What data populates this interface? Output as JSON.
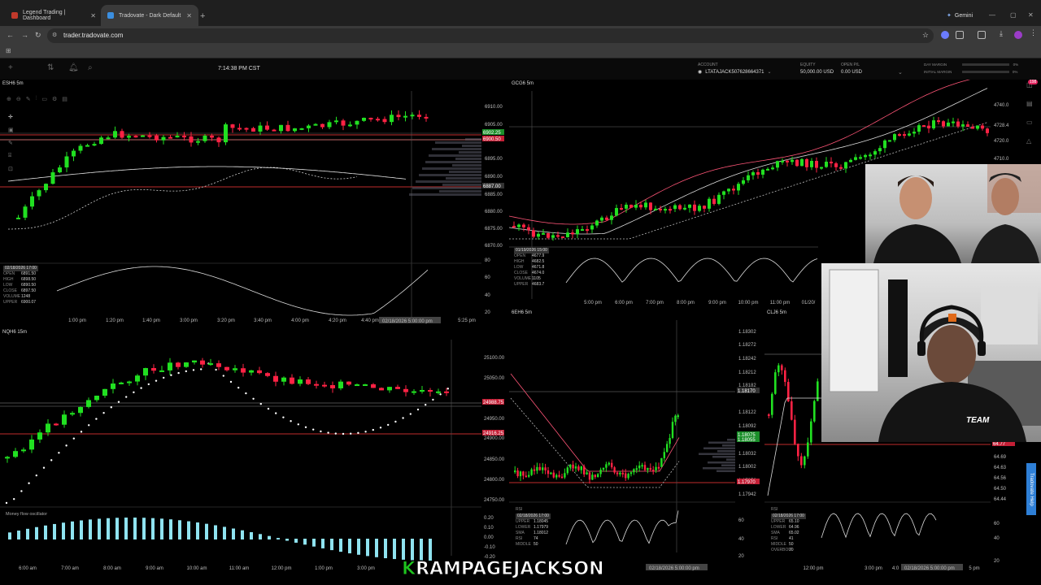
{
  "browser": {
    "tabs": [
      {
        "title": "Legend Trading | Dashboard",
        "active": false,
        "favicon_color": "#c0392b"
      },
      {
        "title": "Tradovate - Dark Default",
        "active": true,
        "favicon_color": "#3b8fe0"
      }
    ],
    "new_tab": "+",
    "gemini": "Gemini",
    "url": "trader.tradovate.com"
  },
  "app": {
    "clock": "7:14:38 PM CST",
    "account_label": "ACCOUNT",
    "account_value": "LTATAJACK507628664371",
    "equity_label": "EQUITY",
    "equity_value": "50,000.00 USD",
    "open_pl_label": "OPEN P/L",
    "open_pl_value": "0.00 USD",
    "day_margin_label": "DAY MARGIN",
    "day_margin_value": "0%",
    "initial_margin_label": "INITIAL MARGIN",
    "initial_margin_value": "0%",
    "notification_count": "198"
  },
  "panels": {
    "es": {
      "title": "ESH6 5m",
      "prices": [
        "6910.00",
        "6905.00",
        "6895.00",
        "6890.00",
        "6885.00",
        "6880.00",
        "6875.00",
        "6870.00"
      ],
      "tags": [
        "6902.25",
        "6900.50",
        "6887.00"
      ],
      "times": [
        "1:00 pm",
        "1:20 pm",
        "1:40 pm",
        "3:00 pm",
        "3:20 pm",
        "3:40 pm",
        "4:00 pm",
        "4:20 pm",
        "4:40 pm",
        "5:25 pm"
      ],
      "cursor_time": "02/18/2026 5:00:00 pm",
      "osc_levels": [
        "80",
        "60",
        "40",
        "20"
      ],
      "ohlc": {
        "date": "02/18/2026 17:00",
        "open": "6891.50",
        "high": "6898.50",
        "low": "6890.50",
        "close": "6897.50",
        "volume": "1248",
        "upper": "6900.07"
      }
    },
    "gc": {
      "title": "GCG6 5m",
      "prices": [
        "4740.0",
        "4728.4",
        "4720.0",
        "4710.0"
      ],
      "times": [
        "5:00 pm",
        "6:00 pm",
        "7:00 pm",
        "8:00 pm",
        "9:00 pm",
        "10:00 pm",
        "11:00 pm",
        "01/20/"
      ],
      "ohlc": {
        "date": "01/19/2026 15:00",
        "open": "4677.9",
        "high": "4682.5",
        "low": "4671.8",
        "close": "4674.0",
        "volume": "1105",
        "upper": "4683.7"
      }
    },
    "nq": {
      "title": "NQH6 15m",
      "prices": [
        "25100.00",
        "25050.00",
        "24950.00",
        "24900.00",
        "24850.00",
        "24800.00",
        "24750.00"
      ],
      "tags": [
        "24988.75",
        "24916.25"
      ],
      "osc_title": "Money flow oscillator",
      "osc_levels": [
        "0.20",
        "0.10",
        "0.00",
        "-0.10",
        "-0.20"
      ],
      "times": [
        "6:00 am",
        "7:00 am",
        "8:00 am",
        "9:00 am",
        "10:00 am",
        "11:00 am",
        "12:00 pm",
        "1:00 pm",
        "3:00 pm"
      ]
    },
    "6e": {
      "title": "6EH6 5m",
      "prices": [
        "1.18302",
        "1.18272",
        "1.18242",
        "1.18212",
        "1.18182",
        "1.18152",
        "1.18122",
        "1.18092",
        "1.18062",
        "1.18032",
        "1.18002",
        "1.17972",
        "1.17942"
      ],
      "tags": [
        "1.18170",
        "1.18075",
        "1.18055",
        "1.17970"
      ],
      "rsi_label": "RSI",
      "rsi_levels": [
        "60",
        "40",
        "20"
      ],
      "cursor_time": "02/18/2026 5:00:00 pm",
      "ohlc": {
        "date": "02/18/2026 17:00",
        "upper": "1.18045",
        "lower": "1.17979",
        "sma": "1.18012",
        "rsi": "74",
        "middle": "50"
      }
    },
    "cl": {
      "title": "CLJ6 5m",
      "prices": [
        "64.69",
        "64.63",
        "64.56",
        "64.50",
        "64.44"
      ],
      "tags": [
        "64.77"
      ],
      "rsi_label": "RSI",
      "rsi_levels": [
        "60",
        "40",
        "20"
      ],
      "times": [
        "12:00 pm",
        "3:00 pm",
        "4:0",
        "5 pm"
      ],
      "cursor_time": "02/18/2026 5:00:00 pm",
      "ohlc": {
        "date": "02/18/2026 17:00",
        "upper": "65.10",
        "lower": "64.96",
        "sma": "65.02",
        "rsi": "41",
        "middle": "50",
        "overbought": "70"
      }
    }
  },
  "side_help": "Tradovate Help",
  "watermark": {
    "k": "K",
    "rest": "RAMPAGEJACKSON"
  },
  "colors": {
    "bull": "#21e021",
    "bear": "#ff2244",
    "bg": "#000000",
    "mfo": "#8fe3f0",
    "accent": "#3b8fe0"
  }
}
